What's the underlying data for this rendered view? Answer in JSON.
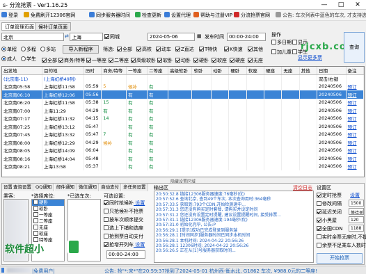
{
  "window": {
    "title": "s- 分流抢票 - Ver1.16.25"
  },
  "menu": [
    {
      "label": "登录",
      "color": "#3b7dd8"
    },
    {
      "label": "免费刷开12306官网",
      "color": "#e0a000"
    },
    {
      "label": "同步服务器时间",
      "color": "#3b7dd8"
    },
    {
      "label": "检查更新",
      "color": "#2aa84a"
    },
    {
      "label": "设置代理",
      "color": "#3b7dd8"
    },
    {
      "label": "帮助与注册VIP",
      "color": "#e06020"
    },
    {
      "label": "分流抢票官网",
      "color": "#d02828"
    },
    {
      "label": "公告: 车次列表中蓝色的车次, 才支持选上下铺和靠窗座位",
      "color": "#999999"
    }
  ],
  "tabs": [
    "订单管理页面",
    "候补订单页面"
  ],
  "query": {
    "from": "北京",
    "to": "上海",
    "same_city_label": "同城",
    "date": "2024-05-06",
    "depart_time_label": "发车时间",
    "depart_time": "00:00-24:00",
    "ops_label": "操作",
    "trip_types": [
      "单程",
      "多程",
      "多站"
    ],
    "passenger_types": [
      "成人",
      "学生"
    ],
    "import_button": "导入新程序",
    "filter_label": "筛选:",
    "filters": [
      "全部",
      "高铁",
      "动车",
      "Z直达",
      "T特快",
      "K快速",
      "其他"
    ],
    "seat_filters": [
      "全部",
      "商务/特等",
      "一等座",
      "二等座",
      "高级软卧",
      "软卧",
      "动卧",
      "硬卧",
      "软座",
      "硬座",
      "无座"
    ],
    "extra_checks": [
      "多日期",
      "显示",
      "加儿童",
      "学生"
    ],
    "right_button": "查询",
    "ad_text": "软件超小",
    "ad_link": "显示更多票"
  },
  "grid": {
    "headers": [
      "出发地",
      "目的地",
      "历时",
      "商务/特等",
      "一等座",
      "二等座",
      "高级软卧",
      "软卧",
      "动卧",
      "硬卧",
      "软座",
      "硬座",
      "无座",
      "其他",
      "日期",
      "备注"
    ],
    "special_row": {
      "from": "(北京南-11)",
      "to": "(上海虹桥49列)",
      "right": "双击/右键"
    },
    "rows": [
      {
        "from": "北京南05:58",
        "to": "上海虹桥11:58",
        "dur": "05:59",
        "c1": "5",
        "c1cls": "o",
        "c2": "候补",
        "c2cls": "o",
        "c3": "有",
        "date": "20240506",
        "note": "预订"
      },
      {
        "from": "北京南06:10",
        "to": "上海虹桥12:06",
        "dur": "05:56",
        "c1": "",
        "c1cls": "",
        "c2": "有",
        "c2cls": "g",
        "c3": "有",
        "date": "20240506",
        "note": "预订",
        "selected": true
      },
      {
        "from": "北京南06:20",
        "to": "上海虹桥11:58",
        "dur": "05:38",
        "c1": "15",
        "c1cls": "g",
        "c2": "有",
        "c2cls": "g",
        "c3": "有",
        "date": "20240506",
        "note": "预订"
      },
      {
        "from": "北京南07:00",
        "to": "上海11:29",
        "dur": "04:29",
        "c1": "有",
        "c1cls": "g",
        "c2": "有",
        "c2cls": "g",
        "c3": "有",
        "date": "20240506",
        "note": "预订"
      },
      {
        "from": "北京南07:17",
        "to": "上海虹桥11:32",
        "dur": "04:15",
        "c1": "14",
        "c1cls": "g",
        "c2": "有",
        "c2cls": "g",
        "c3": "有",
        "date": "20240506",
        "note": "预订"
      },
      {
        "from": "北京南07:25",
        "to": "上海虹桥13:12",
        "dur": "05:47",
        "c1": "",
        "c1cls": "",
        "c2": "有",
        "c2cls": "g",
        "c3": "有",
        "date": "20240506",
        "note": "预订"
      },
      {
        "from": "北京南07:45",
        "to": "上海虹桥13:32",
        "dur": "05:47",
        "c1": "7",
        "c1cls": "g",
        "c2": "有",
        "c2cls": "g",
        "c3": "有",
        "date": "20240506",
        "note": "预订"
      },
      {
        "from": "北京南08:00",
        "to": "上海虹桥12:29",
        "dur": "04:29",
        "c1": "候补",
        "c1cls": "o",
        "c2": "有",
        "c2cls": "g",
        "c3": "有",
        "date": "20240506",
        "note": "预订"
      },
      {
        "from": "北京南08:05",
        "to": "上海虹桥14:09",
        "dur": "06:04",
        "c1": "",
        "c1cls": "",
        "c2": "有",
        "c2cls": "g",
        "c3": "有",
        "date": "20240506",
        "note": "预订"
      },
      {
        "from": "北京南08:16",
        "to": "上海虹桥14:04",
        "dur": "05:48",
        "c1": "",
        "c1cls": "",
        "c2": "有",
        "c2cls": "g",
        "c3": "有",
        "date": "20240506",
        "note": "预订"
      },
      {
        "from": "北京南08:21",
        "to": "上海13:58",
        "dur": "05:37",
        "c1": "",
        "c1cls": "",
        "c2": "有",
        "c2cls": "g",
        "c3": "有",
        "date": "20240506",
        "note": "预订"
      }
    ]
  },
  "splitter": "隐藏设置区域",
  "bottom": {
    "tabs": [
      "设置",
      "查询设置",
      "QQ通知",
      "邮件通知",
      "微信通知",
      "自动支付",
      "多任务设置"
    ],
    "passenger_label": "乘客:",
    "seat_label": "*选择席位:",
    "train_label": "*已选车次:",
    "optional_label": "可选设置:",
    "seats": [
      "硬卧",
      "软卧",
      "一等座",
      "二等座",
      "无座",
      "软座",
      "特等座"
    ],
    "options": [
      {
        "label": "同时抢候补",
        "checked": true,
        "link": "设置"
      },
      {
        "label": "只抢候补不抢票",
        "checked": false
      },
      {
        "label": "按车次顺序提交",
        "checked": false
      },
      {
        "label": "选上下铺和选座",
        "checked": false
      },
      {
        "label": "抢到票自动支付",
        "checked": false
      },
      {
        "label": "抢增开列车",
        "checked": true,
        "link": "设置"
      }
    ],
    "time_range": "00:00-24:00",
    "output_label": "输出区",
    "clear_log": "清空日志",
    "log": [
      "20:50:32.8  链接12306服务器速度:76毫秒(优)",
      "20:57:52.6  查询北京, 查到49个车次, 本次查询用时:364毫秒",
      "20:57:33.5  获取到:793个CDN,开始检测速中...",
      "20:57:31.3  您还没有购买定时套餐, 请购买并设定时间",
      "20:57:31.2  您还没有设置定时提醒, 建议设置提醒时间, 接受排票...",
      "20:57:31.1  链接12306服务器速度:194毫秒(优)",
      "20:57:31.0  初始化完毕, 公告:P",
      "20:56:29.1  [提示]成功已完成登录到服务端",
      "20:56:28.1  [时间同步]服务器时间已同步本机时间",
      "20:56:28.1  本机时间:    2024-04-22  20:56:26",
      "20:56:28.1  12306时间: 2024-04-22  20:56:26",
      "20:56:26.5  正在从[1]号服务器获取时间..."
    ],
    "settings_label": "设置区",
    "settings": [
      {
        "label": "定时抢票",
        "checked": true,
        "link": "设置"
      },
      {
        "label": "修改间隔",
        "checked": false,
        "value": "1500"
      },
      {
        "label": "延迟关闭",
        "checked": true,
        "value": "等待关闭"
      },
      {
        "label": "小黑屋",
        "checked": true,
        "value": "120"
      },
      {
        "label": "全国CDN",
        "checked": true,
        "value": "1188"
      },
      {
        "label": "实时余票无座时,不提交",
        "checked": false
      },
      {
        "label": "余票不足乘车人数时,不提交",
        "checked": false
      }
    ],
    "start_button": "开始抢票",
    "ad_big": "软件超小"
  },
  "status": {
    "mode": "免费用户",
    "ticker": "公告: 抢\"*:宋*\"在20:59:37抢到了2024-05-01 杭州西-衡水北, G1862 车次, ¥988.0元的二等座!"
  }
}
